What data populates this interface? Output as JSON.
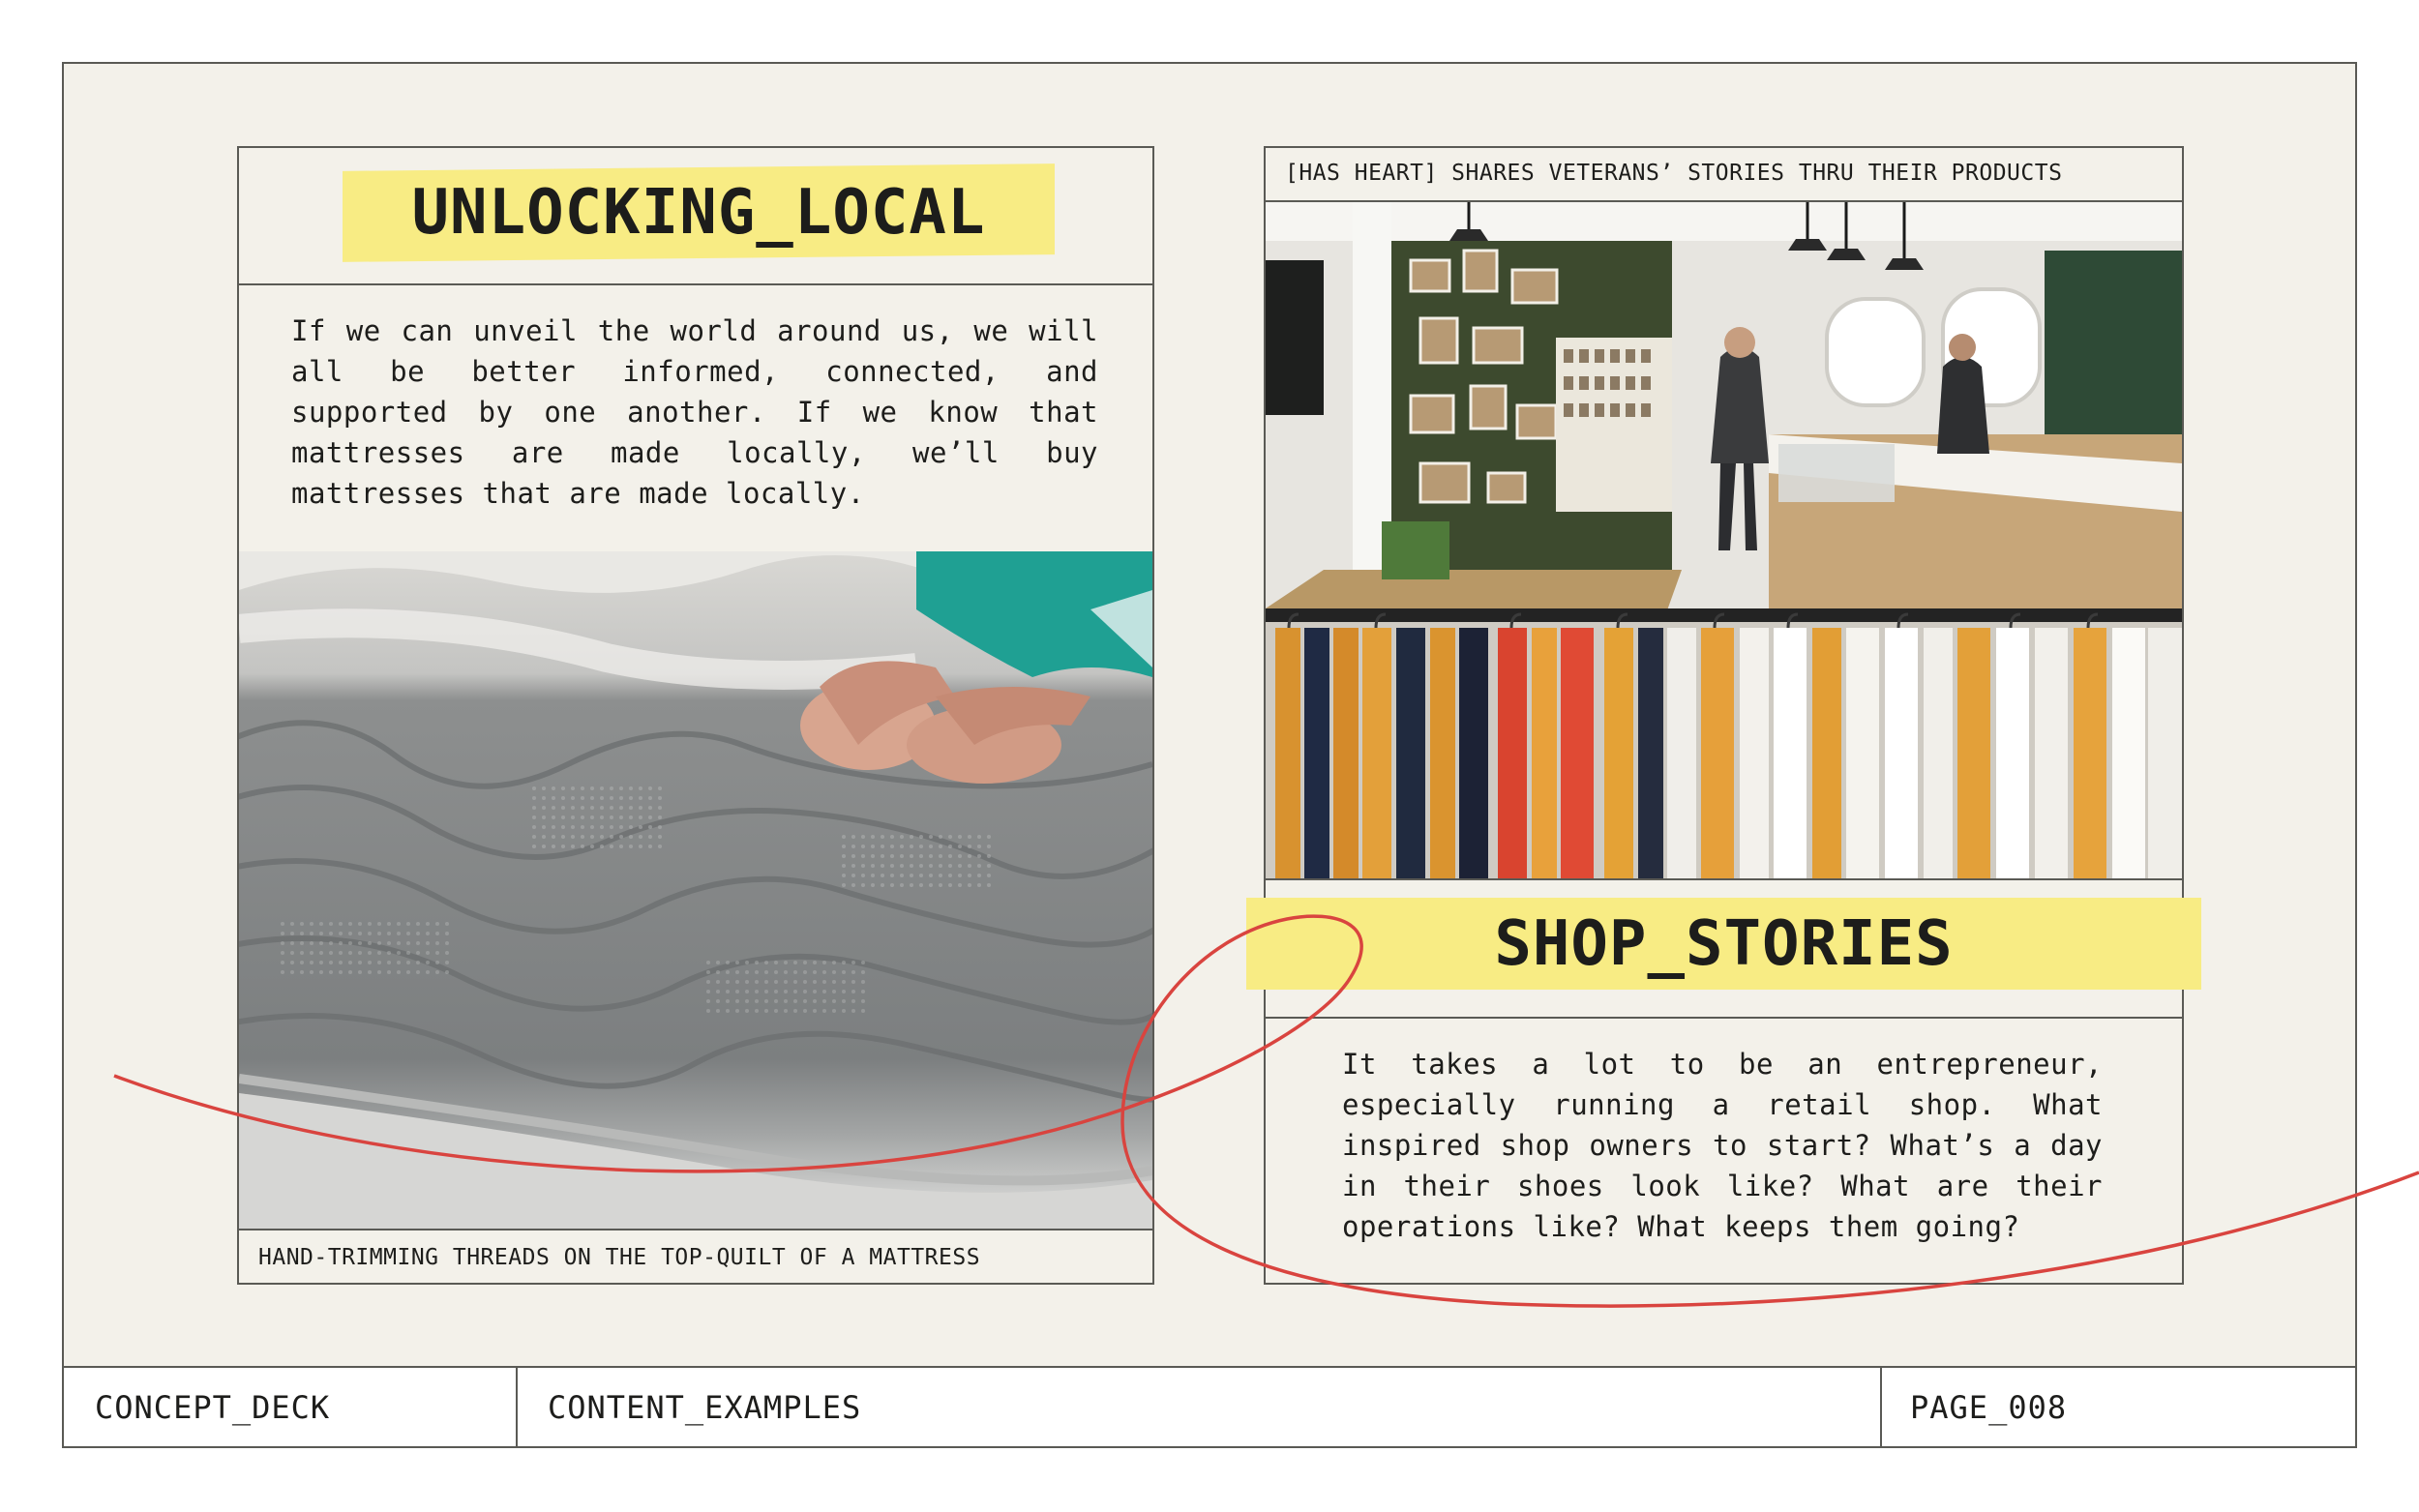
{
  "left_card": {
    "title": "UNLOCKING_LOCAL",
    "body": "If we can unveil the world around us, we will all be better informed, connected, and supported by one another. If we know that mattresses are made locally, we’ll buy mattresses that are made locally.",
    "caption": "HAND-TRIMMING THREADS ON THE TOP-QUILT OF A MATTRESS"
  },
  "right_card": {
    "header": "[HAS HEART] SHARES VETERANS’ STORIES THRU THEIR PRODUCTS",
    "title": "SHOP_STORIES",
    "body": "It takes a lot to be an entrepreneur, especially running a retail shop. What inspired shop owners to start? What’s a day in their shoes look like? What are their operations like? What keeps them going?"
  },
  "footer": {
    "left": "CONCEPT_DECK",
    "middle": "CONTENT_EXAMPLES",
    "right": "PAGE_008"
  },
  "colors": {
    "background": "#f3f1ea",
    "highlight": "#f8ec84",
    "accent_line": "#d9443f",
    "border": "#5a5a55"
  }
}
